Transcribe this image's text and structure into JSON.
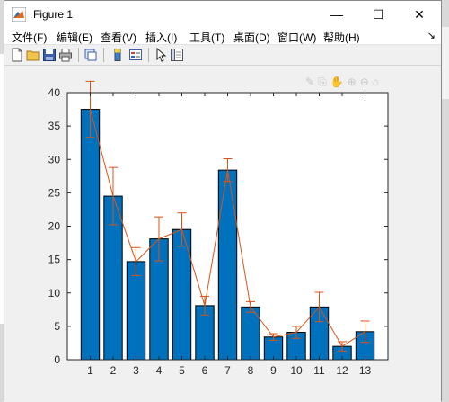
{
  "window": {
    "title": "Figure 1",
    "minimize_glyph": "—",
    "maximize_glyph": "☐",
    "close_glyph": "✕"
  },
  "menu": [
    {
      "label": "文件(F)"
    },
    {
      "label": "编辑(E)"
    },
    {
      "label": "查看(V)"
    },
    {
      "label": "插入(I)"
    },
    {
      "label": "工具(T)"
    },
    {
      "label": "桌面(D)"
    },
    {
      "label": "窗口(W)"
    },
    {
      "label": "帮助(H)"
    }
  ],
  "toolbar_icons": [
    "new-figure-icon",
    "open-file-icon",
    "save-icon",
    "print-icon",
    "link-plot-icon",
    "insert-colorbar-icon",
    "insert-legend-icon",
    "pointer-icon",
    "property-inspector-icon"
  ],
  "axes_toolbar_icons": [
    "brush-icon",
    "export-icon",
    "pan-icon",
    "zoom-in-icon",
    "zoom-out-icon",
    "home-icon"
  ],
  "colors": {
    "bar": "#0072BD",
    "line": "#D95319",
    "axes_bg": "#ffffff",
    "figure_bg": "#f0f0f0"
  },
  "chart_data": {
    "type": "bar",
    "categories": [
      "1",
      "2",
      "3",
      "4",
      "5",
      "6",
      "7",
      "8",
      "9",
      "10",
      "11",
      "12",
      "13"
    ],
    "values": [
      37.5,
      24.5,
      14.7,
      18.1,
      19.5,
      8.1,
      28.4,
      7.9,
      3.4,
      4.1,
      7.9,
      2.0,
      4.2
    ],
    "errors": [
      4.2,
      4.3,
      2.1,
      3.3,
      2.5,
      1.4,
      1.7,
      0.8,
      0.5,
      0.9,
      2.2,
      0.7,
      1.6
    ],
    "line_overlay": true,
    "ylim": [
      0,
      40
    ],
    "yticks": [
      "0",
      "5",
      "10",
      "15",
      "20",
      "25",
      "30",
      "35",
      "40"
    ],
    "grid": false
  }
}
